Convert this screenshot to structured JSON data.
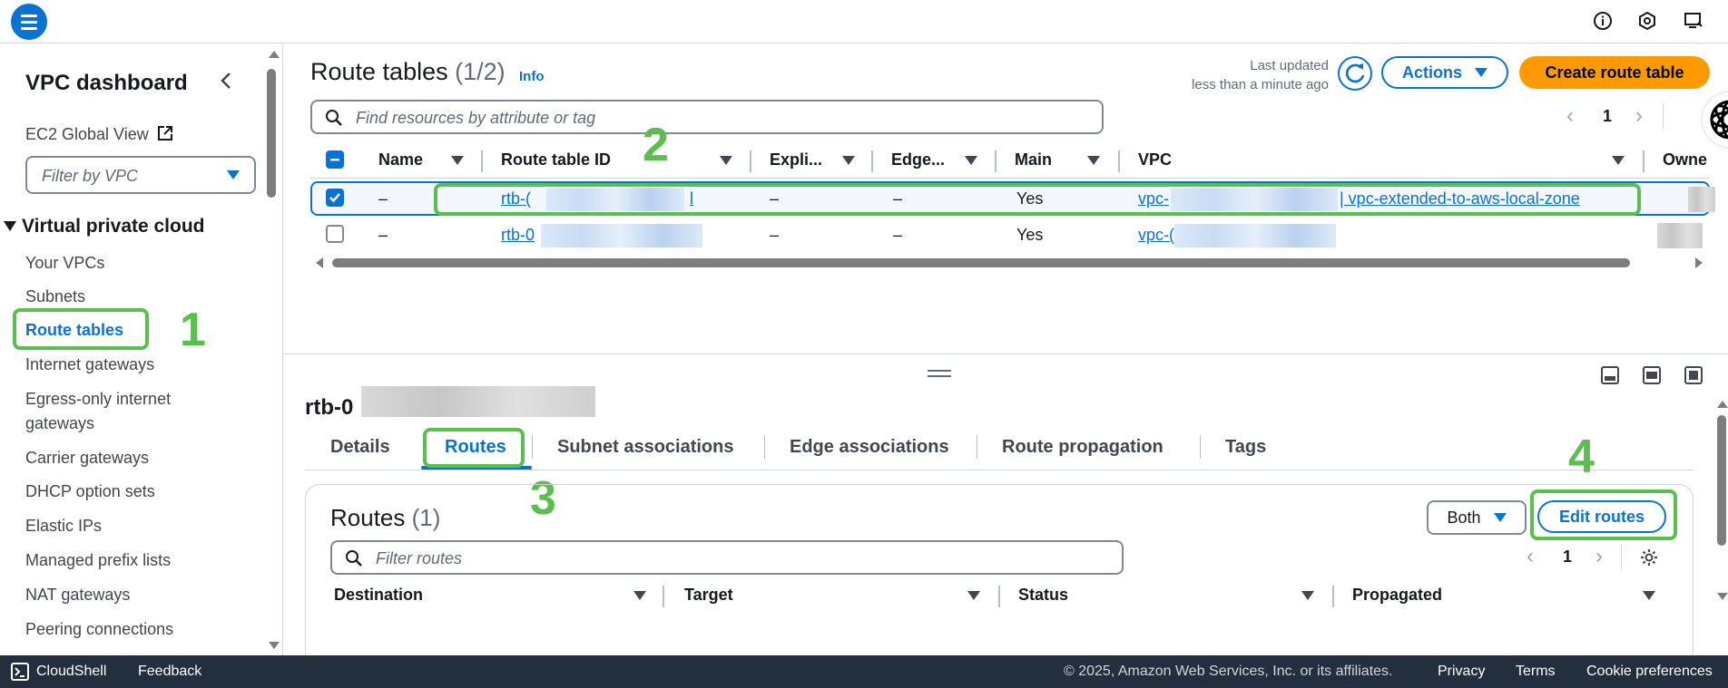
{
  "topbar": {
    "menu_icon": "hamburger-icon",
    "icons": [
      "info-icon",
      "notifications-icon",
      "settings-icon"
    ]
  },
  "sidebar": {
    "title": "VPC dashboard",
    "ec2_global_view": "EC2 Global View",
    "filter_placeholder": "Filter by VPC",
    "section": "Virtual private cloud",
    "items": [
      {
        "label": "Your VPCs"
      },
      {
        "label": "Subnets"
      },
      {
        "label": "Route tables",
        "active": true
      },
      {
        "label": "Internet gateways"
      },
      {
        "label": "Egress-only internet"
      },
      {
        "label": "gateways"
      },
      {
        "label": "Carrier gateways"
      },
      {
        "label": "DHCP option sets"
      },
      {
        "label": "Elastic IPs"
      },
      {
        "label": "Managed prefix lists"
      },
      {
        "label": "NAT gateways"
      },
      {
        "label": "Peering connections"
      }
    ]
  },
  "route_tables": {
    "title": "Route tables",
    "count": "(1/2)",
    "info": "Info",
    "last_updated_label": "Last updated",
    "last_updated_value": "less than a minute ago",
    "actions_label": "Actions",
    "create_label": "Create route table",
    "search_placeholder": "Find resources by attribute or tag",
    "page": "1",
    "columns": [
      "Name",
      "Route table ID",
      "Expli...",
      "Edge...",
      "Main",
      "VPC",
      "Owne"
    ],
    "rows": [
      {
        "name": "–",
        "id": "rtb-(",
        "id_tail": "l",
        "explicit": "–",
        "edge": "–",
        "main": "Yes",
        "vpc": "vpc-",
        "vpc_name": "| vpc-extended-to-aws-local-zone",
        "selected": true
      },
      {
        "name": "–",
        "id": "rtb-0",
        "id_tail": "",
        "explicit": "–",
        "edge": "–",
        "main": "Yes",
        "vpc": "vpc-(",
        "vpc_name": "",
        "selected": false
      }
    ]
  },
  "detail": {
    "title": "rtb-0",
    "tabs": [
      "Details",
      "Routes",
      "Subnet associations",
      "Edge associations",
      "Route propagation",
      "Tags"
    ],
    "active_tab": "Routes",
    "routes_title": "Routes",
    "routes_count": "(1)",
    "both_label": "Both",
    "edit_label": "Edit routes",
    "filter_placeholder": "Filter routes",
    "page": "1",
    "columns": [
      "Destination",
      "Target",
      "Status",
      "Propagated"
    ]
  },
  "annotations": [
    "1",
    "2",
    "3",
    "4"
  ],
  "footer": {
    "cloudshell": "CloudShell",
    "feedback": "Feedback",
    "copyright": "© 2025, Amazon Web Services, Inc. or its affiliates.",
    "privacy": "Privacy",
    "terms": "Terms",
    "cookies": "Cookie preferences"
  },
  "colors": {
    "accent": "#0972d3",
    "primary_button": "#ff9900",
    "annotation": "#5bbf4e",
    "footer_bg": "#232f3e"
  }
}
